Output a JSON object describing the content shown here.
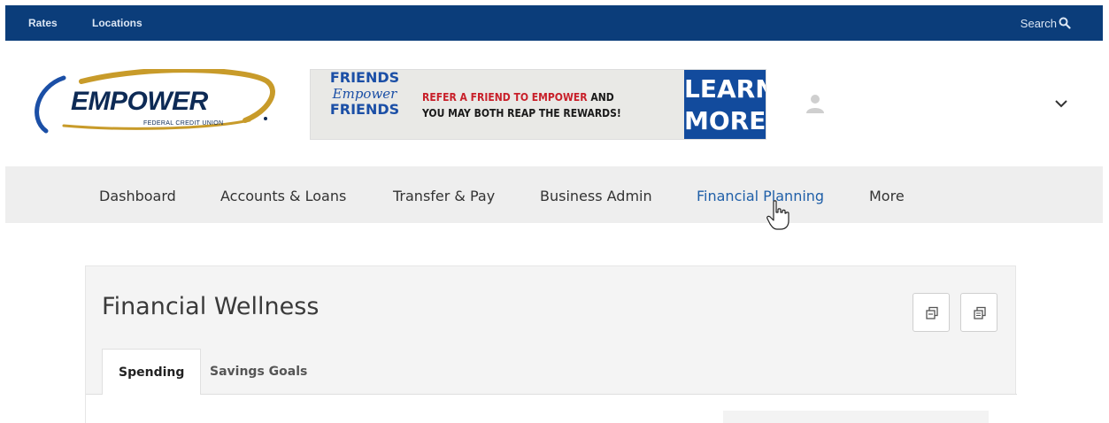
{
  "topbar": {
    "links": [
      "Rates",
      "Locations"
    ],
    "search_label": "Search",
    "icons": {
      "search": "search-icon"
    },
    "bg_color": "#0b3d7a"
  },
  "header": {
    "logo": {
      "name": "EMPOWER",
      "subtitle": "FEDERAL CREDIT UNION"
    },
    "banner": {
      "friends_line1": "FRIENDS",
      "friends_script": "Empower",
      "friends_line3": "FRIENDS",
      "message_red": "REFER A FRIEND TO EMPOWER",
      "message_rest_1": " AND",
      "message_line2": "YOU MAY BOTH REAP THE REWARDS!",
      "cta_line1": "LEARN",
      "cta_line2": "MORE"
    },
    "icons": {
      "avatar": "user-avatar-icon",
      "menu": "chevron-down-icon"
    }
  },
  "nav": {
    "items": [
      {
        "label": "Dashboard",
        "active": false
      },
      {
        "label": "Accounts & Loans",
        "active": false
      },
      {
        "label": "Transfer & Pay",
        "active": false
      },
      {
        "label": "Business Admin",
        "active": false
      },
      {
        "label": "Financial Planning",
        "active": true
      },
      {
        "label": "More",
        "active": false
      }
    ],
    "active_color": "#1f5fa8"
  },
  "card": {
    "title": "Financial Wellness",
    "buttons": [
      "expand-icon",
      "popout-icon"
    ],
    "tabs": [
      {
        "label": "Spending",
        "active": true
      },
      {
        "label": "Savings Goals",
        "active": false
      }
    ]
  }
}
